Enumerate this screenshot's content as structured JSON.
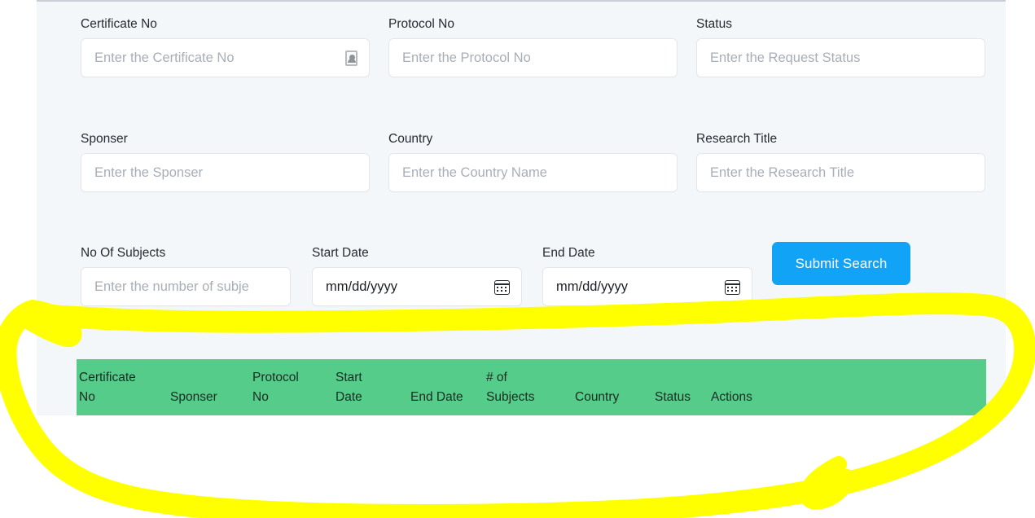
{
  "search_form": {
    "fields": [
      {
        "label": "Certificate No",
        "placeholder": "Enter the Certificate No",
        "icon": "autofill-card-icon"
      },
      {
        "label": "Protocol No",
        "placeholder": "Enter the Protocol No",
        "icon": ""
      },
      {
        "label": "Status",
        "placeholder": "Enter the Request Status",
        "icon": ""
      },
      {
        "label": "Sponser",
        "placeholder": "Enter the Sponser",
        "icon": ""
      },
      {
        "label": "Country",
        "placeholder": "Enter the Country Name",
        "icon": ""
      },
      {
        "label": "Research Title",
        "placeholder": "Enter the Research Title",
        "icon": ""
      },
      {
        "label": "No Of Subjects",
        "placeholder": "Enter the number of subje",
        "icon": ""
      },
      {
        "label": "Start Date",
        "placeholder": "mm/dd/yyyy",
        "icon": "calendar-icon"
      },
      {
        "label": "End Date",
        "placeholder": "mm/dd/yyyy",
        "icon": "calendar-icon"
      }
    ],
    "submit_label": "Submit Search"
  },
  "results_table": {
    "columns": [
      {
        "line1": "Certificate",
        "line2": "No"
      },
      {
        "line1": "",
        "line2": "Sponser"
      },
      {
        "line1": "Protocol",
        "line2": "No"
      },
      {
        "line1": "Start",
        "line2": "Date"
      },
      {
        "line1": "",
        "line2": "End Date"
      },
      {
        "line1": "# of",
        "line2": "Subjects"
      },
      {
        "line1": "",
        "line2": "Country"
      },
      {
        "line1": "",
        "line2": "Status"
      },
      {
        "line1": "",
        "line2": "Actions"
      }
    ]
  },
  "colors": {
    "panel_background": "#f4f7fa",
    "submit_button": "#11a3f5",
    "table_header": "#55cc8a",
    "annotation_highlight": "#ffff00",
    "label_text": "#262b33",
    "placeholder_text": "#a8aeb8"
  },
  "annotation": {
    "shape": "hand-drawn-yellow-circle",
    "target": "results-table"
  }
}
